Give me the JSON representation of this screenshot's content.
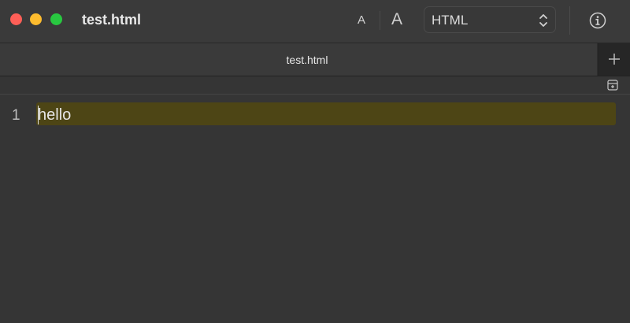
{
  "window": {
    "title": "test.html"
  },
  "toolbar": {
    "font_smaller_label": "A",
    "font_larger_label": "A",
    "language": "HTML",
    "info_icon": "info-circle-icon"
  },
  "tabs": [
    {
      "label": "test.html",
      "active": true
    }
  ],
  "new_tab_icon": "plus-icon",
  "fold_icon": "fold-toggle-icon",
  "editor": {
    "lines": [
      {
        "number": "1",
        "text": "hello"
      }
    ]
  },
  "colors": {
    "background": "#353535",
    "current_line_highlight": "#4d4515",
    "close": "#fe5f57",
    "minimize": "#febc2e",
    "maximize": "#28c840"
  }
}
